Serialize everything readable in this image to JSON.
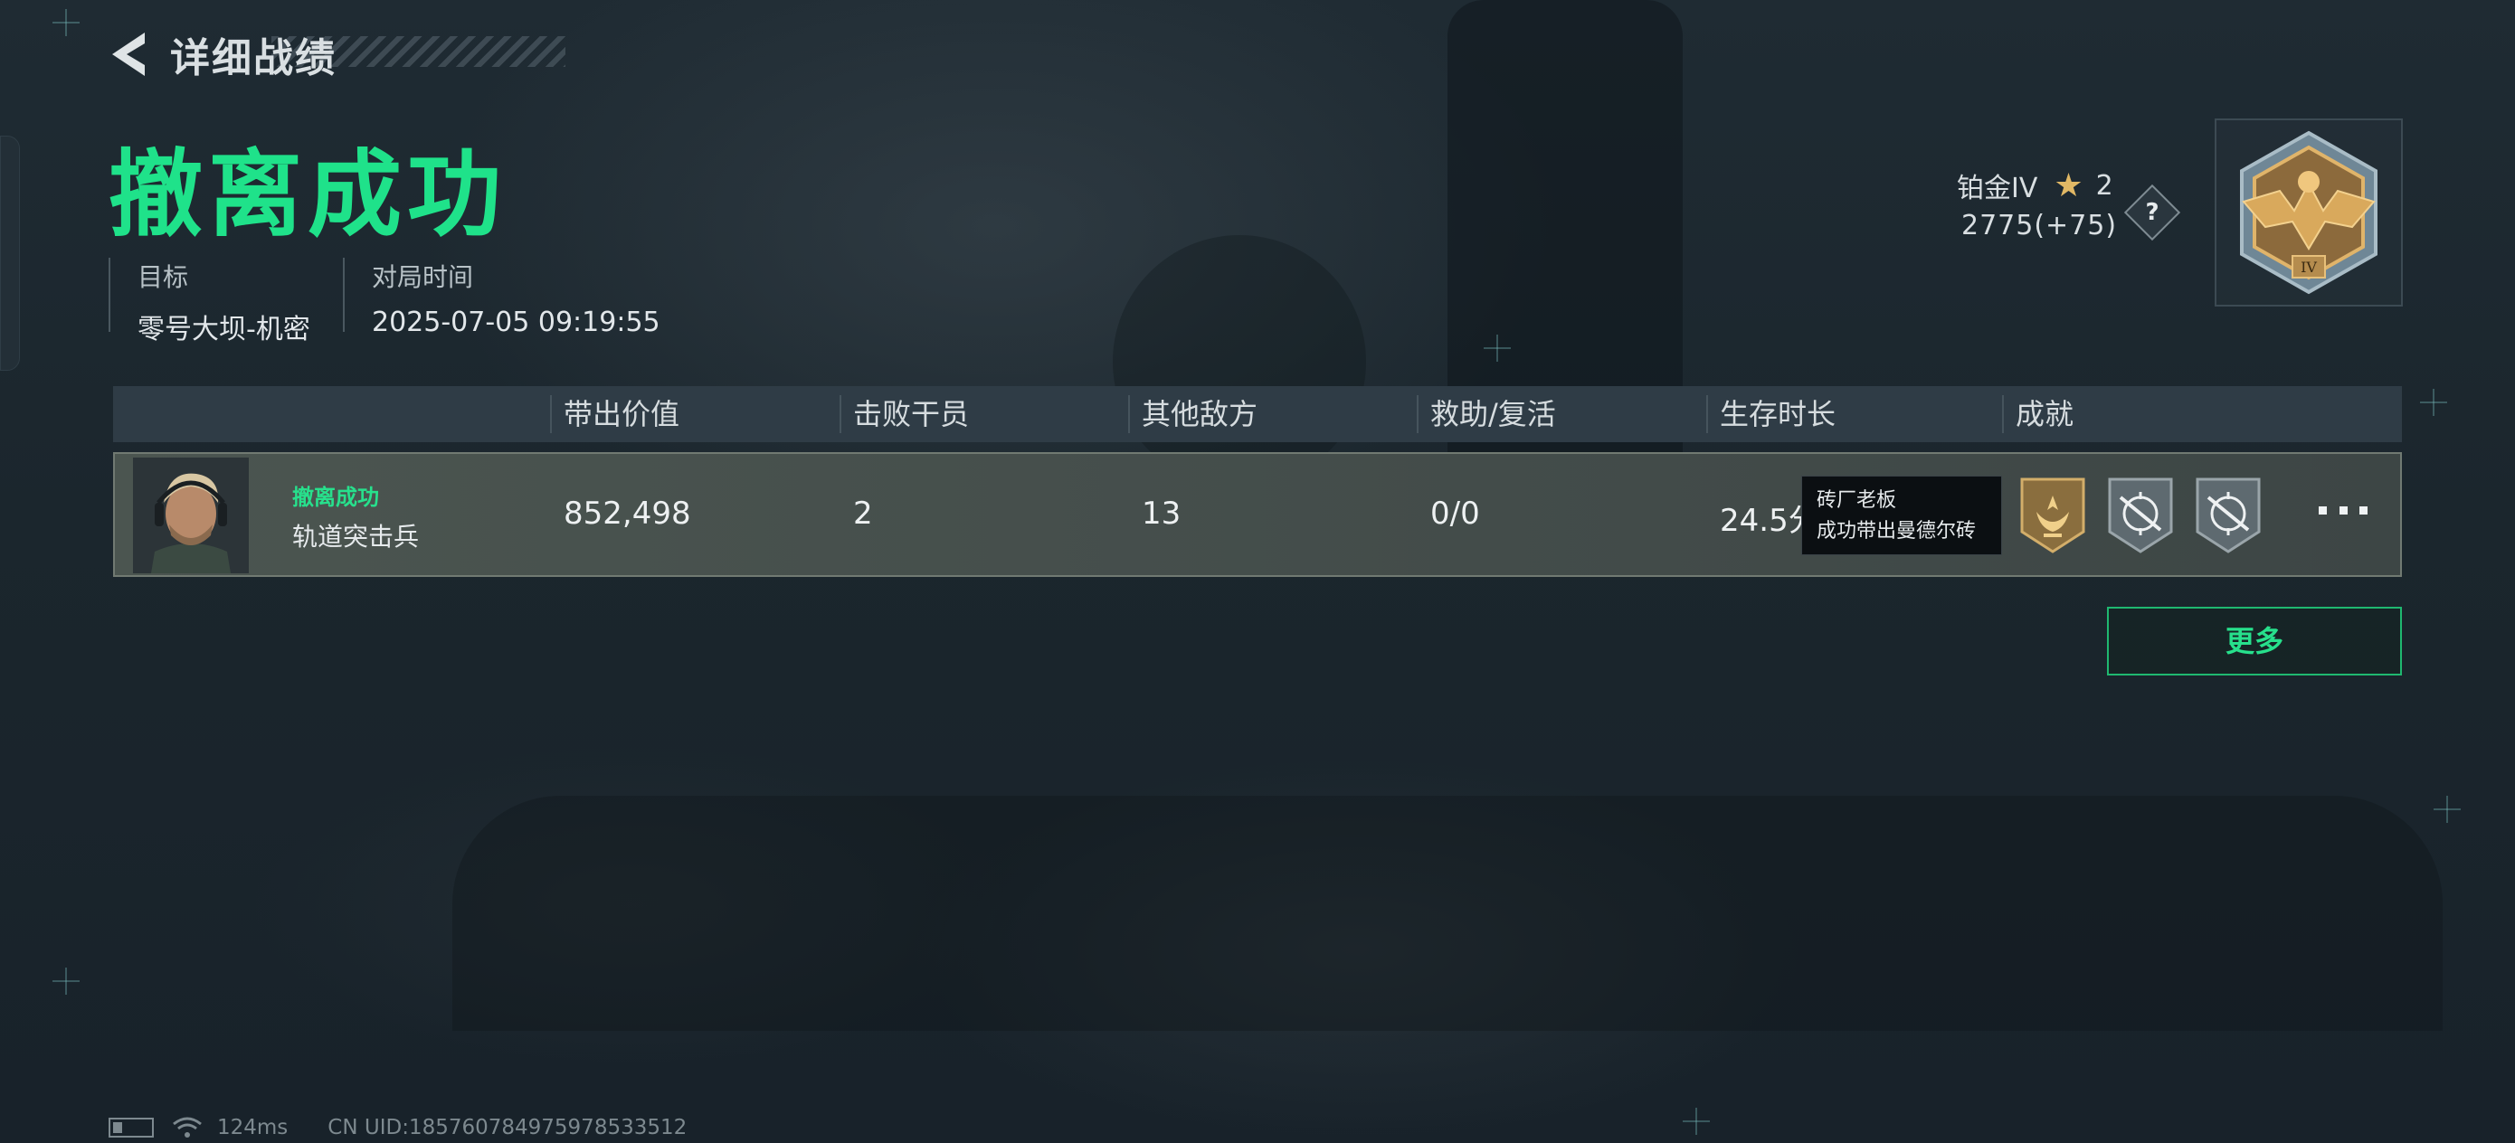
{
  "header": {
    "title": "详细战绩",
    "result": "撤离成功"
  },
  "info": {
    "target_label": "目标",
    "target_value": "零号大坝-机密",
    "time_label": "对局时间",
    "time_value": "2025-07-05 09:19:55"
  },
  "rank": {
    "tier": "铂金IV",
    "stars": "2",
    "score": "2775(+75)",
    "help": "?",
    "badge_numeral": "IV"
  },
  "table": {
    "columns": [
      "带出价值",
      "击败干员",
      "其他敌方",
      "救助/复活",
      "生存时长",
      "成就"
    ],
    "row": {
      "status": "撤离成功",
      "class": "轨道突击兵",
      "value": "852,498",
      "kills": "2",
      "other_enemies": "13",
      "assist_revive": "0/0",
      "survival_time": "24.5分"
    },
    "tooltip": {
      "title": "砖厂老板",
      "desc": "成功带出曼德尔砖"
    },
    "achievements": [
      "gold-laurel-badge",
      "crosshair-badge",
      "crosshair-badge"
    ]
  },
  "more_button": "更多",
  "status_bar": {
    "ping": "124ms",
    "uid": "CN UID:18576078497597853351​2"
  },
  "colors": {
    "accent_green": "#1fe28a",
    "gold": "#e1b865"
  }
}
